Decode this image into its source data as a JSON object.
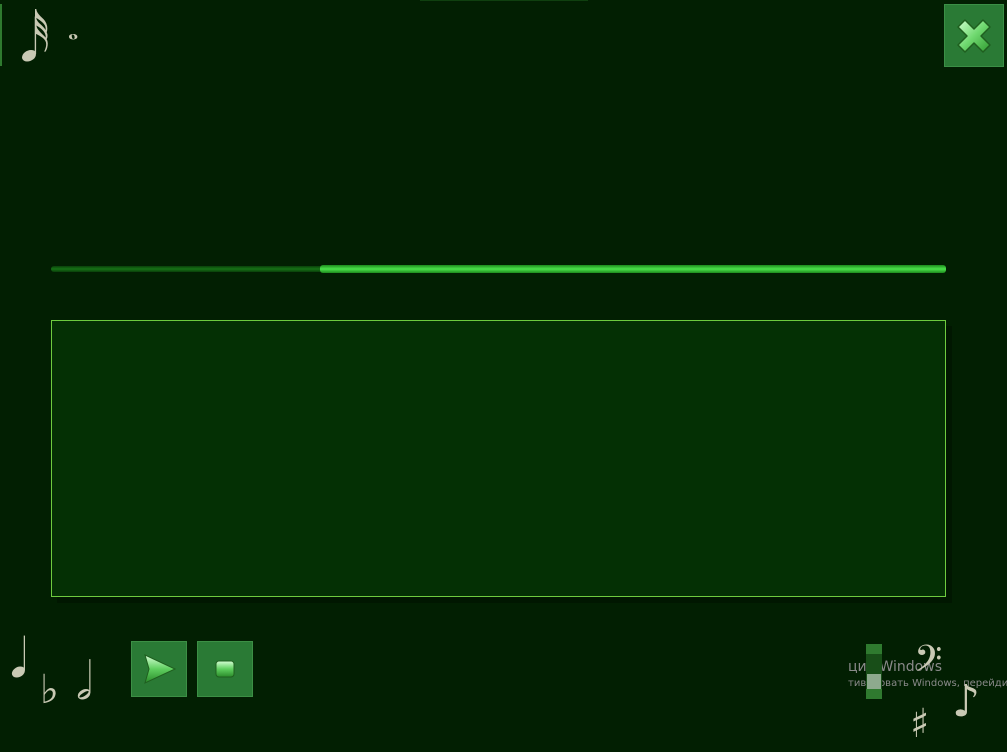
{
  "window": {
    "close_icon": "close-x-icon"
  },
  "decorations": {
    "top_note_1": "𝅘𝅥𝅰",
    "top_note_2": "𝅝",
    "bottom_note_quarter": "𝅘𝅥",
    "bottom_flat": "♭",
    "bottom_note_half": "𝅗𝅥",
    "bottom_bass_clef": "𝄢",
    "bottom_sharp": "♯",
    "bottom_note_eighth": "♪"
  },
  "progress": {
    "value_fraction": 0.7
  },
  "controls": {
    "play_icon": "play-icon",
    "stop_icon": "stop-icon"
  },
  "watermark": {
    "line1": "ция Windows",
    "line2": "тивировать Windows, перейдите"
  },
  "colors": {
    "background": "#021f02",
    "button": "#2a7a35",
    "progress": "#4be24b",
    "panel_border": "#6ecb3f"
  }
}
